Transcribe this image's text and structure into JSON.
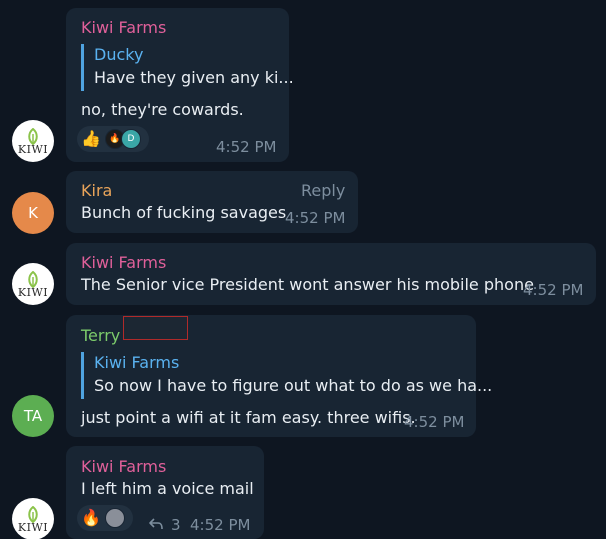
{
  "colors": {
    "background": "#0e1621",
    "bubble": "#182533",
    "name_pink": "#e0609a",
    "name_orange": "#e9a45a",
    "name_green": "#7ccb6b",
    "reply_blue": "#5ab2f0",
    "time_gray": "#7d8e9e"
  },
  "messages": [
    {
      "sender": "Kiwi Farms",
      "reply": {
        "name": "Ducky",
        "text": "Have they given any ki..."
      },
      "text": "no, they're cowards.",
      "time": "4:52 PM",
      "reactions": [
        "thumbs-up-emoji",
        "flame-avatar",
        "D"
      ]
    },
    {
      "sender": "Kira",
      "action": "Reply",
      "text": "Bunch of fucking savages",
      "time": "4:52 PM",
      "avatar_initials": "K"
    },
    {
      "sender": "Kiwi Farms",
      "text": "The Senior vice President wont answer his mobile phone",
      "time": "4:52 PM"
    },
    {
      "sender": "Terry",
      "reply": {
        "name": "Kiwi Farms",
        "text": "So now I have to figure out what to do as we ha..."
      },
      "text": "just point a wifi at it fam easy. three wifis.",
      "time": "4:52 PM",
      "avatar_initials": "TA"
    },
    {
      "sender": "Kiwi Farms",
      "text": "I left him a voice mail",
      "time": "4:52 PM",
      "reply_count": "3",
      "reactions": [
        "fire-emoji",
        "avatar"
      ]
    }
  ],
  "logo_text": "KIWI"
}
